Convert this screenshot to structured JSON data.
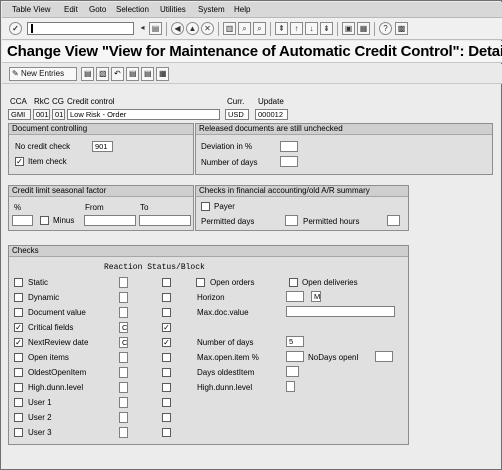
{
  "menu": [
    "Table View",
    "Edit",
    "Goto",
    "Selection",
    "Utilities",
    "System",
    "Help"
  ],
  "title": "Change View \"View for Maintenance of Automatic Credit Control\": Detail",
  "app_toolbar": {
    "new_entries": "New Entries"
  },
  "header": {
    "cca_label": "CCA",
    "rkc_label": "RkC",
    "cg_label": "CG",
    "credit_control_label": "Credit control",
    "curr_label": "Curr.",
    "update_label": "Update",
    "cca_value": "GMI",
    "rkc_value": "001",
    "cg_value": "01",
    "credit_control_value": "Low Risk - Order",
    "curr_value": "USD",
    "update_value": "000012"
  },
  "doc_controlling": {
    "title": "Document controlling",
    "no_credit_check_label": "No credit check",
    "no_credit_check_value": "901",
    "item_check_label": "Item check",
    "item_check_checked": true
  },
  "released": {
    "title": "Released documents are still unchecked",
    "deviation_label": "Deviation in %",
    "days_label": "Number of days"
  },
  "seasonal": {
    "title": "Credit limit seasonal factor",
    "pct_label": "%",
    "from_label": "From",
    "to_label": "To",
    "minus_label": "Minus"
  },
  "fin_checks": {
    "title": "Checks in financial accounting/old A/R summary",
    "payer_label": "Payer",
    "permitted_days_label": "Permitted days",
    "permitted_hours_label": "Permitted hours"
  },
  "checks": {
    "title": "Checks",
    "reaction_header": "Reaction Status/Block",
    "rows": [
      {
        "label": "Static",
        "checked": false,
        "reaction": "",
        "status": false
      },
      {
        "label": "Dynamic",
        "checked": false,
        "reaction": "",
        "status": false
      },
      {
        "label": "Document value",
        "checked": false,
        "reaction": "",
        "status": false
      },
      {
        "label": "Critical fields",
        "checked": true,
        "reaction": "C",
        "status": true
      },
      {
        "label": "NextReview date",
        "checked": true,
        "reaction": "C",
        "status": true
      },
      {
        "label": "Open items",
        "checked": false,
        "reaction": "",
        "status": false
      },
      {
        "label": "OldestOpenItem",
        "checked": false,
        "reaction": "",
        "status": false
      },
      {
        "label": "High.dunn.level",
        "checked": false,
        "reaction": "",
        "status": false
      },
      {
        "label": "User 1",
        "checked": false,
        "reaction": "",
        "status": false
      },
      {
        "label": "User 2",
        "checked": false,
        "reaction": "",
        "status": false
      },
      {
        "label": "User 3",
        "checked": false,
        "reaction": "",
        "status": false
      }
    ],
    "open_orders_label": "Open orders",
    "open_deliveries_label": "Open deliveries",
    "horizon_label": "Horizon",
    "horizon_unit": "M",
    "max_doc_value_label": "Max.doc.value",
    "number_of_days_label": "Number of days",
    "number_of_days_value": "5",
    "max_open_item_label": "Max.open.item %",
    "nodays_openi_label": "NoDays openI",
    "days_oldest_label": "Days oldestItem",
    "high_dunn_label": "High.dunn.level"
  },
  "check_mark": "✓"
}
